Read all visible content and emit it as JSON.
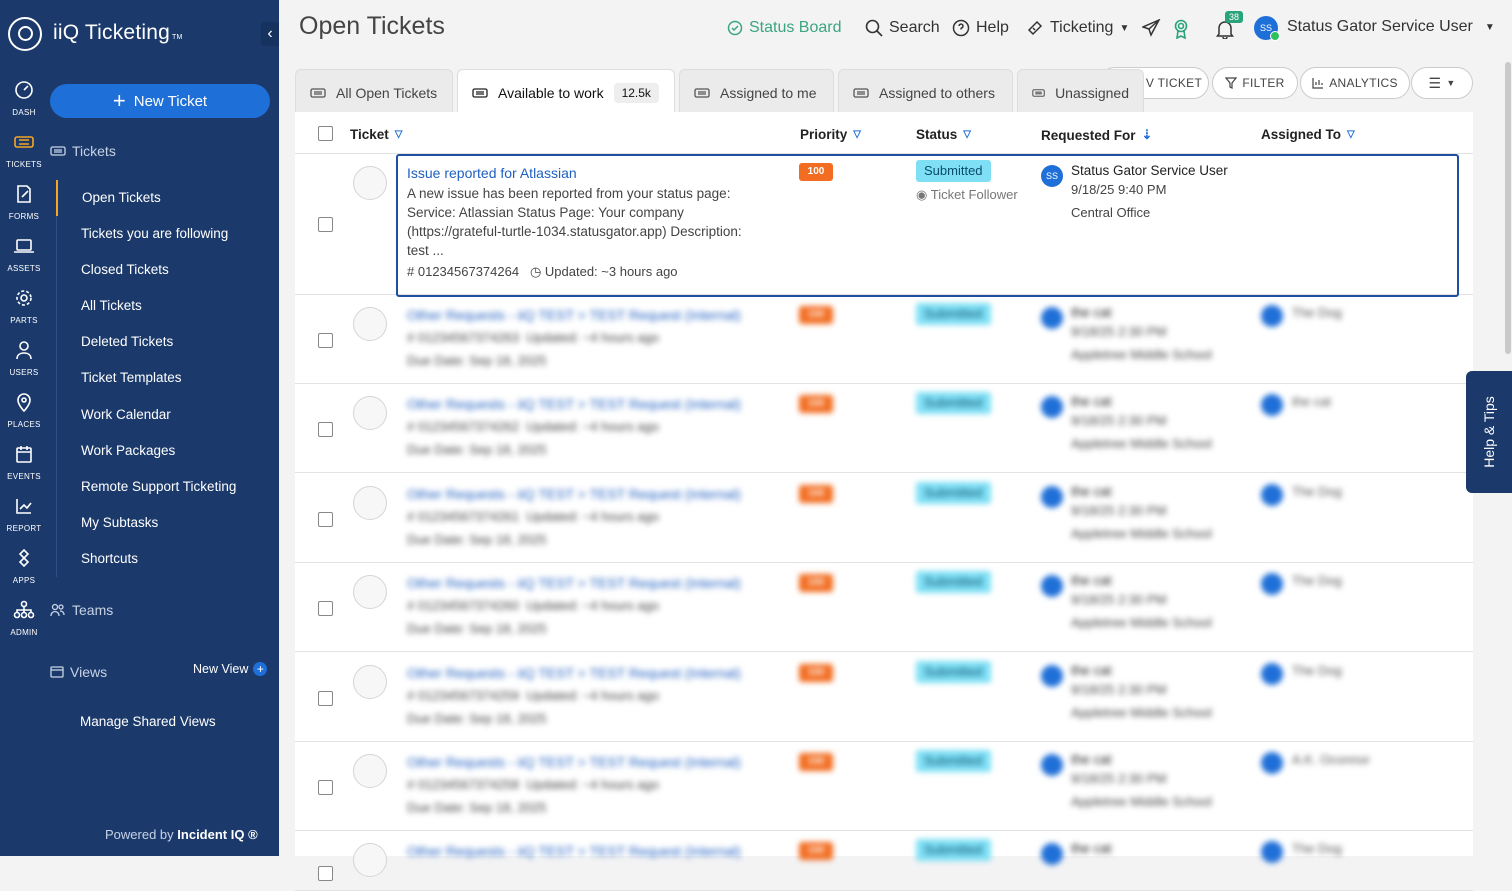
{
  "app": {
    "name": "iiQ Ticketing",
    "tm": "TM",
    "powered_prefix": "Powered by",
    "powered_brand": "Incident IQ ®"
  },
  "rail": [
    {
      "label": "DASH",
      "icon": "dashboard-icon"
    },
    {
      "label": "TICKETS",
      "icon": "ticket-icon"
    },
    {
      "label": "FORMS",
      "icon": "forms-icon"
    },
    {
      "label": "ASSETS",
      "icon": "laptop-icon"
    },
    {
      "label": "PARTS",
      "icon": "gear-icon"
    },
    {
      "label": "USERS",
      "icon": "user-icon"
    },
    {
      "label": "PLACES",
      "icon": "location-pin-icon"
    },
    {
      "label": "EVENTS",
      "icon": "calendar-icon"
    },
    {
      "label": "REPORT",
      "icon": "chart-icon"
    },
    {
      "label": "APPS",
      "icon": "apps-icon"
    },
    {
      "label": "ADMIN",
      "icon": "org-chart-icon"
    }
  ],
  "sidebar": {
    "new_ticket": "New Ticket",
    "tickets_heading": "Tickets",
    "items": [
      "Open Tickets",
      "Tickets you are following",
      "Closed Tickets",
      "All Tickets",
      "Deleted Tickets",
      "Ticket Templates",
      "Work Calendar",
      "Work Packages",
      "Remote Support Ticketing",
      "My Subtasks",
      "Shortcuts"
    ],
    "teams": "Teams",
    "views": "Views",
    "new_view": "New View",
    "manage_shared_views": "Manage Shared Views"
  },
  "header": {
    "title": "Open Tickets",
    "status_board": "Status Board",
    "search": "Search",
    "help": "Help",
    "ticketing": "Ticketing",
    "notifications": "38",
    "user_initials": "SS",
    "user_name": "Status Gator Service User"
  },
  "toolbar": {
    "new_ticket_partial": "V TICKET",
    "filter": "FILTER",
    "analytics": "ANALYTICS"
  },
  "tabs": [
    {
      "label": "All Open Tickets",
      "count": ""
    },
    {
      "label": "Available to work",
      "count": "12.5k"
    },
    {
      "label": "Assigned to me",
      "count": ""
    },
    {
      "label": "Assigned to others",
      "count": ""
    },
    {
      "label": "Unassigned",
      "count": ""
    }
  ],
  "columns": {
    "ticket": "Ticket",
    "priority": "Priority",
    "status": "Status",
    "requested_for": "Requested For",
    "assigned_to": "Assigned To"
  },
  "featured": {
    "title": "Issue reported for Atlassian",
    "desc1": "A new issue has been reported from your status page:",
    "desc2": "Service: Atlassian Status Page: Your company",
    "desc3": "(https://grateful-turtle-1034.statusgator.app) Description:",
    "desc4": "test ...",
    "number": "01234567374264",
    "updated": "Updated: ~3 hours ago",
    "priority": "100",
    "status": "Submitted",
    "follower": "Ticket Follower",
    "req_initials": "SS",
    "req_name": "Status Gator Service User",
    "req_date": "9/18/25 9:40 PM",
    "req_loc": "Central Office"
  },
  "rows": [
    {
      "title": "Other Requests - iiQ TEST > TEST Request (Internal)",
      "number": "# 01234567374263",
      "updated": "Updated: ~4 hours ago",
      "due": "Due Date: Sep 18, 2025",
      "priority": "100",
      "status": "Submitted",
      "req": "the cat",
      "date": "9/18/25 2:30 PM",
      "loc": "Appletree Middle School",
      "assignee": "The Dog"
    },
    {
      "title": "Other Requests - iiQ TEST > TEST Request (Internal)",
      "number": "# 01234567374262",
      "updated": "Updated: ~4 hours ago",
      "due": "Due Date: Sep 18, 2025",
      "priority": "100",
      "status": "Submitted",
      "req": "the cat",
      "date": "9/18/25 2:30 PM",
      "loc": "Appletree Middle School",
      "assignee": "the cat"
    },
    {
      "title": "Other Requests - iiQ TEST > TEST Request (Internal)",
      "number": "# 01234567374261",
      "updated": "Updated: ~4 hours ago",
      "due": "Due Date: Sep 18, 2025",
      "priority": "100",
      "status": "Submitted",
      "req": "the cat",
      "date": "9/18/25 2:30 PM",
      "loc": "Appletree Middle School",
      "assignee": "The Dog"
    },
    {
      "title": "Other Requests - iiQ TEST > TEST Request (Internal)",
      "number": "# 01234567374260",
      "updated": "Updated: ~4 hours ago",
      "due": "Due Date: Sep 18, 2025",
      "priority": "100",
      "status": "Submitted",
      "req": "the cat",
      "date": "9/18/25 2:30 PM",
      "loc": "Appletree Middle School",
      "assignee": "The Dog"
    },
    {
      "title": "Other Requests - iiQ TEST > TEST Request (Internal)",
      "number": "# 01234567374259",
      "updated": "Updated: ~4 hours ago",
      "due": "Due Date: Sep 18, 2025",
      "priority": "100",
      "status": "Submitted",
      "req": "the cat",
      "date": "9/18/25 2:30 PM",
      "loc": "Appletree Middle School",
      "assignee": "The Dog"
    },
    {
      "title": "Other Requests - iiQ TEST > TEST Request (Internal)",
      "number": "# 01234567374258",
      "updated": "Updated: ~4 hours ago",
      "due": "Due Date: Sep 18, 2025",
      "priority": "100",
      "status": "Submitted",
      "req": "the cat",
      "date": "9/18/25 2:30 PM",
      "loc": "Appletree Middle School",
      "assignee": "A.K. Oconnor"
    },
    {
      "title": "Other Requests - iiQ TEST > TEST Request (Internal)",
      "number": "",
      "updated": "",
      "due": "",
      "priority": "100",
      "status": "Submitted",
      "req": "the cat",
      "date": "",
      "loc": "",
      "assignee": "The Dog"
    }
  ],
  "help_tab": "Help & Tips",
  "colors": {
    "sidebar": "#1b3a6b",
    "accent": "#1f6fd8",
    "active": "#f5a623",
    "priority": "#f26d21",
    "status": "#7fe0f5"
  }
}
